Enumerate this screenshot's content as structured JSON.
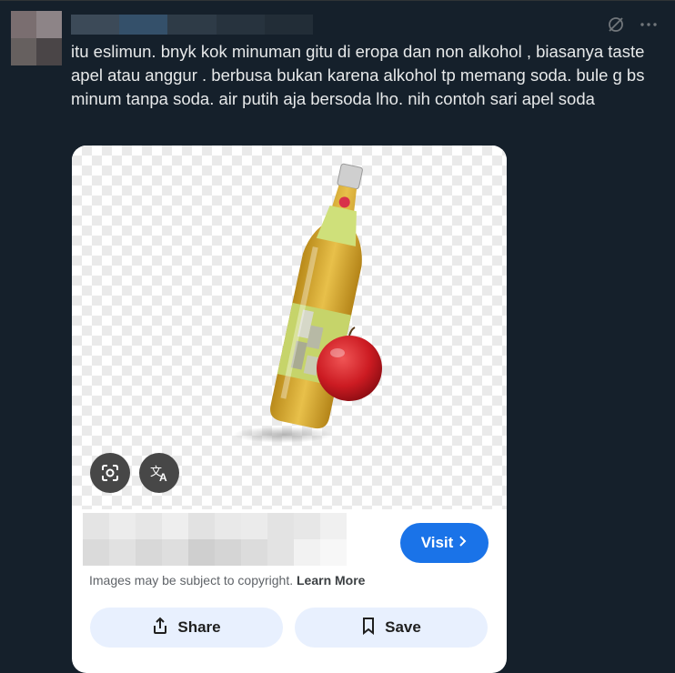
{
  "tweet": {
    "text": "itu eslimun. bnyk kok minuman gitu di eropa dan non alkohol , biasanya taste apel atau anggur . berbusa bukan karena alkohol tp memang soda. bule g bs minum tanpa soda. air putih aja bersoda lho. nih contoh sari apel soda"
  },
  "card": {
    "visit_label": "Visit",
    "copyright_text": "Images may be subject to copyright.",
    "learn_more": "Learn More",
    "share_label": "Share",
    "save_label": "Save",
    "lens_icon": "lens-icon",
    "translate_icon": "translate-icon",
    "accent_color": "#1a73e8"
  },
  "icons": {
    "grok": "grok-icon",
    "more": "more-icon"
  }
}
